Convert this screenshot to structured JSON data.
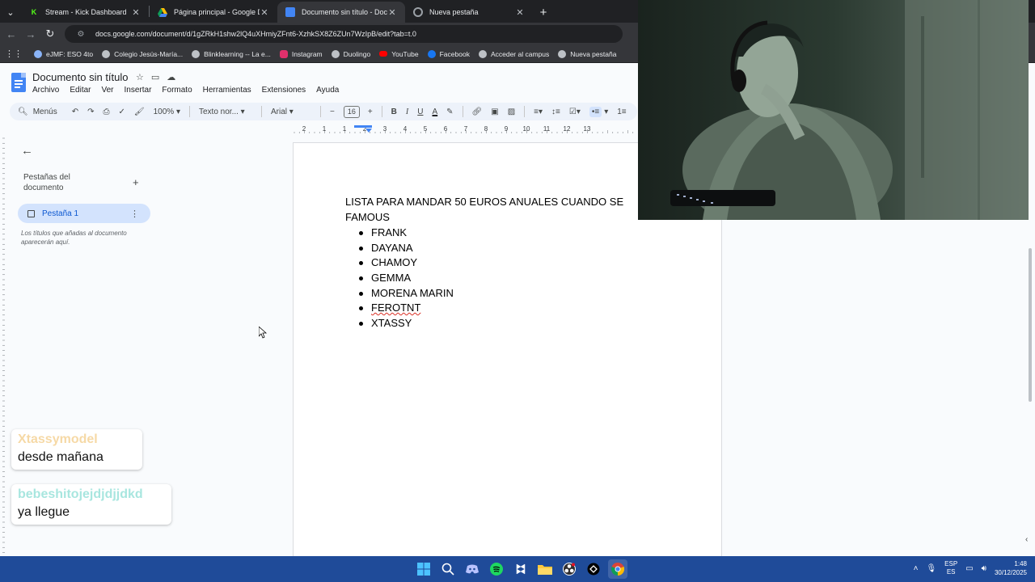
{
  "browser": {
    "tabs": [
      {
        "title": "Stream - Kick Dashboard",
        "icon": "kick-icon",
        "active": false
      },
      {
        "title": "Página principal - Google Drive",
        "icon": "google-drive-icon",
        "active": false
      },
      {
        "title": "Documento sin título - Docum",
        "icon": "google-docs-icon",
        "active": true
      },
      {
        "title": "Nueva pestaña",
        "icon": "chrome-icon",
        "active": false
      }
    ],
    "url": "docs.google.com/document/d/1gZRkH1shw2lQ4uXHmiyZFnt6-XzhkSX8Z6ZUn7WzIpB/edit?tab=t.0",
    "bookmarks": [
      {
        "label": "eJMF: ESO 4to",
        "color": "#8ab4f8"
      },
      {
        "label": "Colegio Jesús-María...",
        "color": "#bdc1c6"
      },
      {
        "label": "Blinklearning -- La e...",
        "color": "#bdc1c6"
      },
      {
        "label": "Instagram",
        "color": "#e1306c"
      },
      {
        "label": "Duolingo",
        "color": "#bdc1c6"
      },
      {
        "label": "YouTube",
        "color": "#ff0000"
      },
      {
        "label": "Facebook",
        "color": "#1877f2"
      },
      {
        "label": "Acceder al campus",
        "color": "#bdc1c6"
      },
      {
        "label": "Nueva pestaña",
        "color": "#bdc1c6"
      }
    ]
  },
  "docs": {
    "title": "Documento sin título",
    "menu": [
      "Archivo",
      "Editar",
      "Ver",
      "Insertar",
      "Formato",
      "Herramientas",
      "Extensiones",
      "Ayuda"
    ],
    "toolbar": {
      "search": "Menús",
      "zoom": "100%",
      "style": "Texto nor...",
      "font": "Arial",
      "font_size": "16"
    },
    "sidebar": {
      "heading": "Pestañas del documento",
      "tab_label": "Pestaña 1",
      "hint": "Los títulos que añadas al documento aparecerán aquí."
    },
    "ruler_numbers": [
      "2",
      "1",
      "1",
      "2",
      "3",
      "4",
      "5",
      "6",
      "7",
      "8",
      "9",
      "10",
      "11",
      "12",
      "13"
    ],
    "content": {
      "heading_line1": "LISTA PARA MANDAR 50 EUROS ANUALES CUANDO SE",
      "heading_line2": "FAMOUS",
      "items": [
        "FRANK",
        "DAYANA",
        "CHAMOY",
        "GEMMA",
        "MORENA MARIN",
        "FEROTNT",
        "XTASSY"
      ]
    }
  },
  "chat": [
    {
      "user": "Xtassymodel",
      "message": "desde mañana",
      "color": "#f6d9a6"
    },
    {
      "user": "bebeshitojejdjdjjdkd",
      "message": "ya llegue",
      "color": "#a8e6df"
    }
  ],
  "taskbar": {
    "lang1": "ESP",
    "lang2": "ES",
    "time": "1:48",
    "date": "30/12/2025"
  }
}
